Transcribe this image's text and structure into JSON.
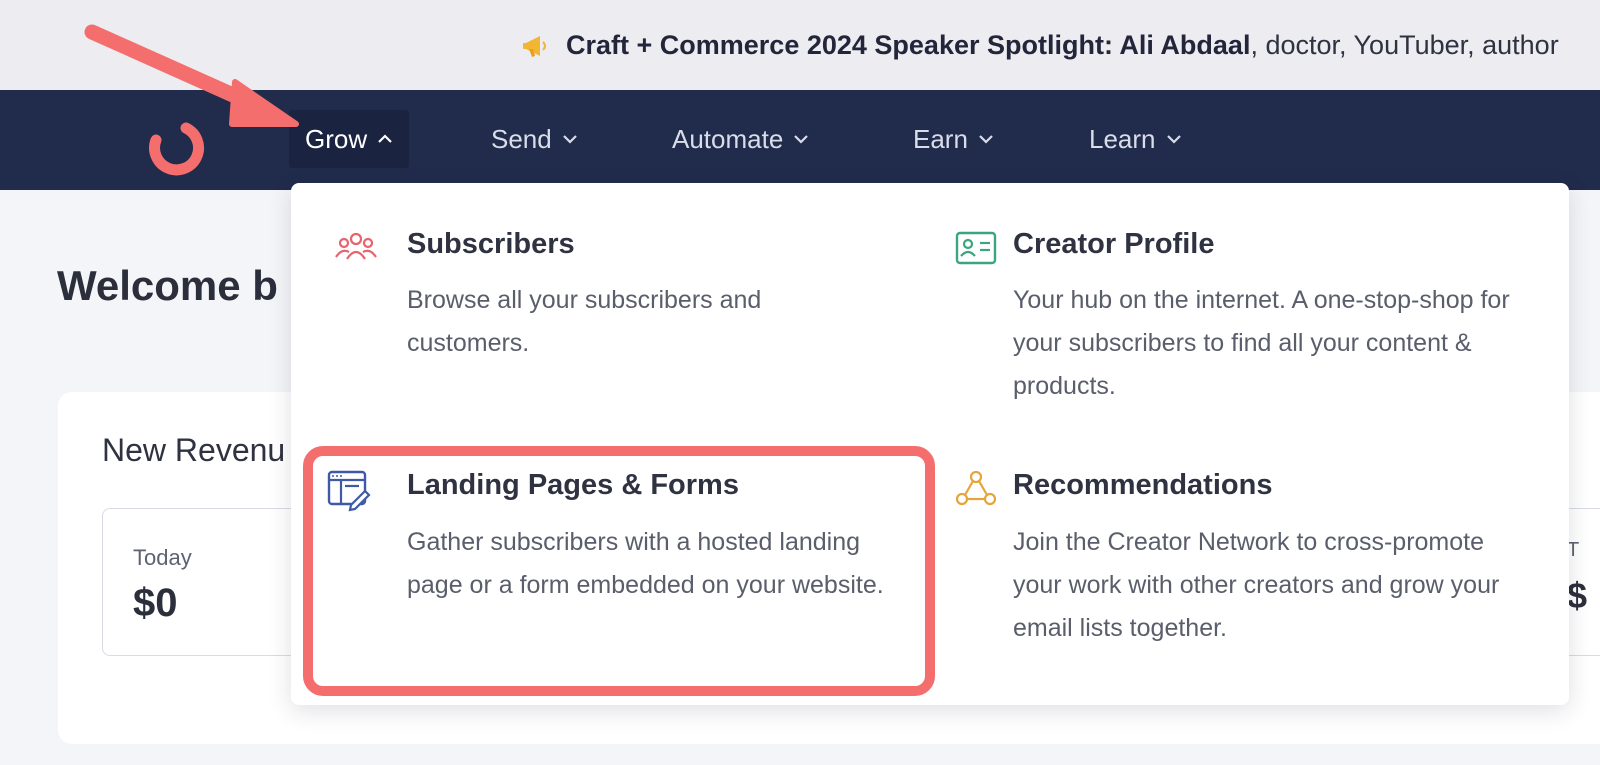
{
  "announcement": {
    "bold": "Craft + Commerce 2024 Speaker Spotlight: Ali Abdaal",
    "rest": ", doctor, YouTuber, author",
    "icon": "megaphone-icon"
  },
  "nav": {
    "items": [
      {
        "label": "Grow",
        "expanded": true
      },
      {
        "label": "Send",
        "expanded": false
      },
      {
        "label": "Automate",
        "expanded": false
      },
      {
        "label": "Earn",
        "expanded": false
      },
      {
        "label": "Learn",
        "expanded": false
      }
    ]
  },
  "main": {
    "welcome": "Welcome b",
    "card_title": "New Revenu",
    "stats": [
      {
        "label": "Today",
        "value": "$0"
      }
    ],
    "partial_stat": {
      "label": "T",
      "value": "$"
    }
  },
  "dropdown": {
    "items": [
      {
        "title": "Subscribers",
        "desc": "Browse all your subscribers and customers.",
        "icon": "users-icon",
        "icon_color": "#e8636b"
      },
      {
        "title": "Creator Profile",
        "desc": "Your hub on the internet. A one-stop-shop for your subscribers to find all your content & products.",
        "icon": "profile-card-icon",
        "icon_color": "#3aa57e"
      },
      {
        "title": "Landing Pages & Forms",
        "desc": "Gather subscribers with a hosted landing page or a form embedded on your website.",
        "icon": "landing-page-icon",
        "icon_color": "#3f59a8"
      },
      {
        "title": "Recommendations",
        "desc": "Join the Creator Network to cross-promote your work with other creators and grow your email lists together.",
        "icon": "network-icon",
        "icon_color": "#e6a53a"
      }
    ]
  },
  "colors": {
    "nav_bg": "#212b4b",
    "accent_red": "#f46e6e",
    "brand": "#f46e6e"
  }
}
